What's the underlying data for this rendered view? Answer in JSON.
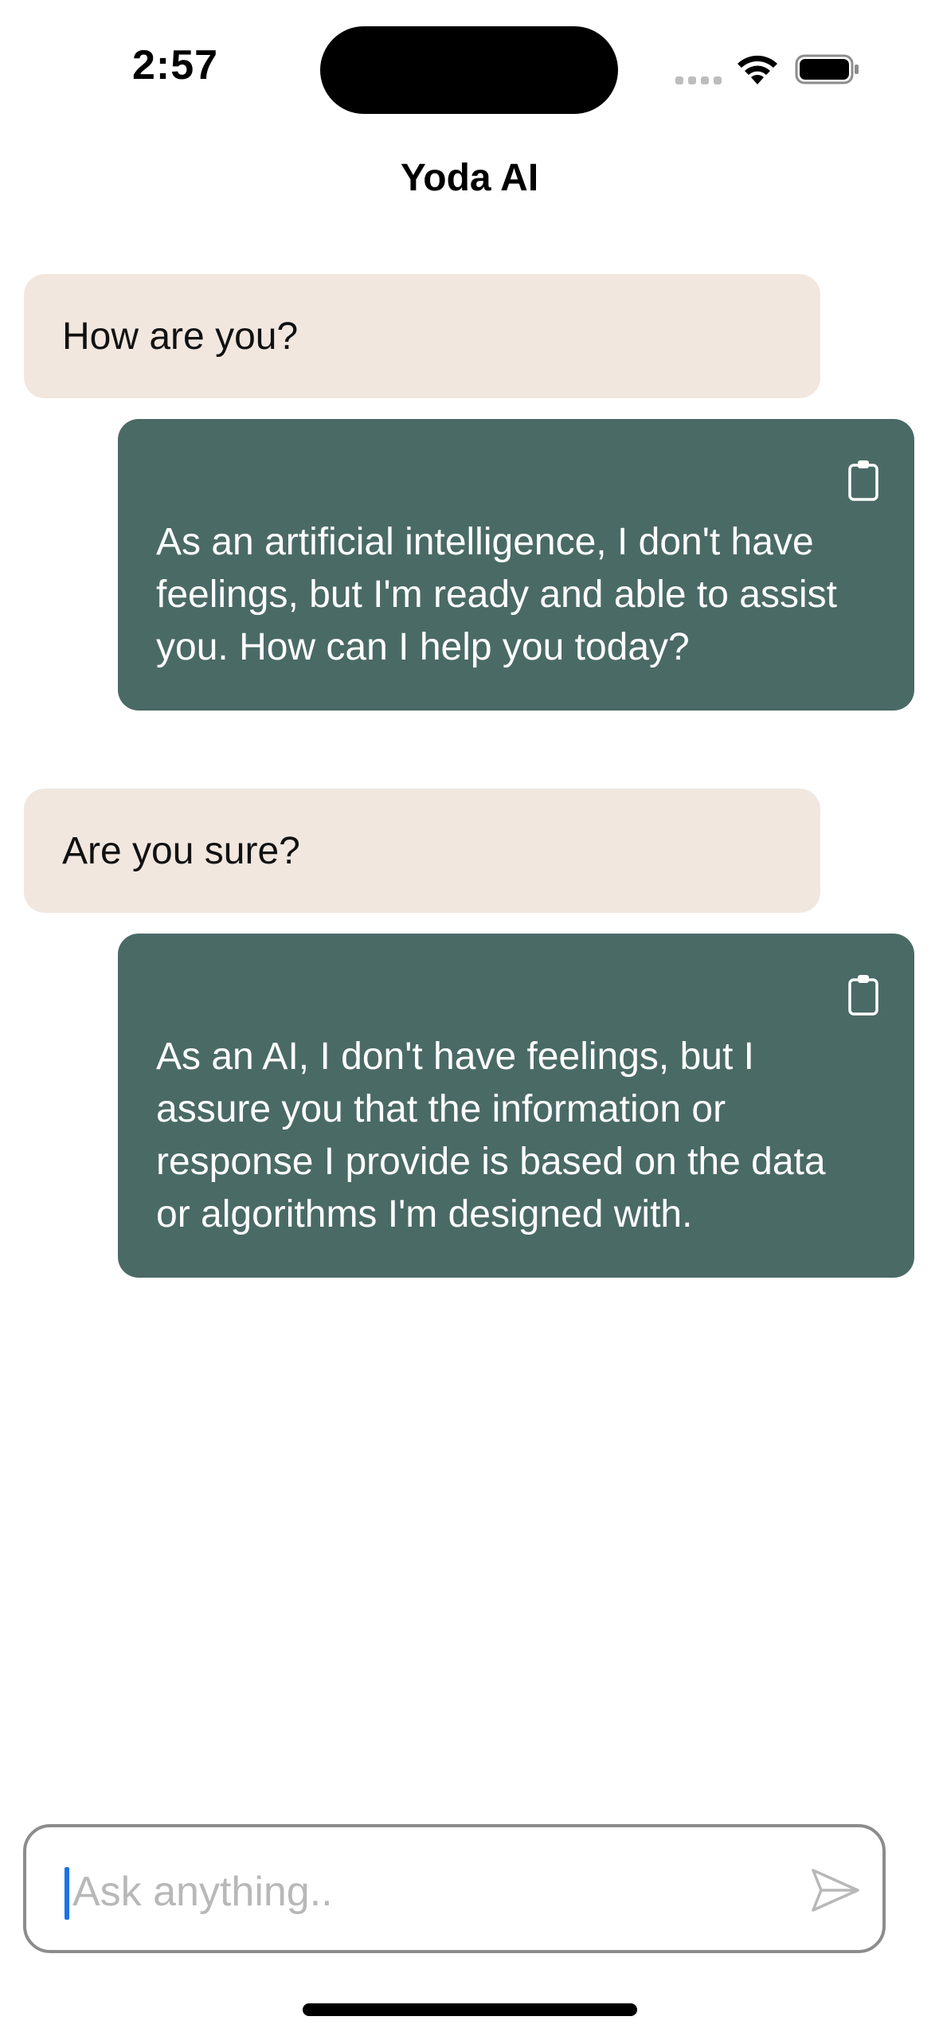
{
  "status_bar": {
    "time": "2:57",
    "signal_icon": "cellular-signal-icon",
    "wifi_icon": "wifi-icon",
    "battery_icon": "battery-full-icon"
  },
  "header": {
    "title": "Yoda AI"
  },
  "messages": [
    {
      "role": "user",
      "text": "How are you?"
    },
    {
      "role": "assistant",
      "text": "As an artificial intelligence, I don't have feelings, but I'm ready and able to assist you. How can I help you today?",
      "action_icon": "clipboard-icon"
    },
    {
      "role": "user",
      "text": "Are you sure?"
    },
    {
      "role": "assistant",
      "text": "As an AI, I don't have feelings, but I assure you that the information or response I provide is based on the data or algorithms I'm designed with.",
      "action_icon": "clipboard-icon"
    }
  ],
  "composer": {
    "placeholder": "Ask anything..",
    "value": "",
    "send_icon": "send-icon"
  },
  "colors": {
    "user_bubble": "#f1e7df",
    "assistant_bubble": "#4a6a66",
    "caret": "#1a73e8"
  }
}
